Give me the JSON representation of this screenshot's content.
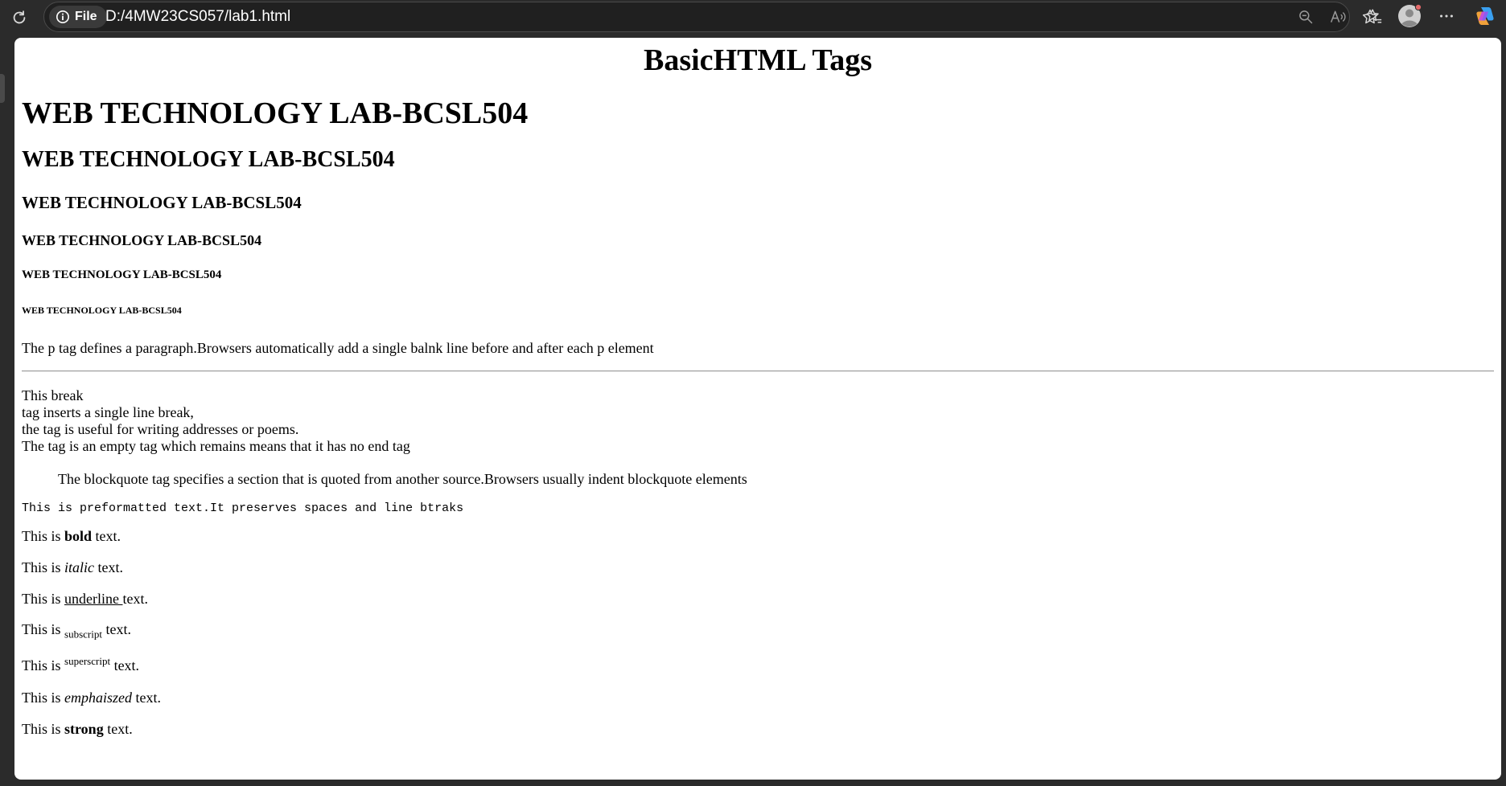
{
  "browser": {
    "site_info_label": "File",
    "url": "D:/4MW23CS057/lab1.html"
  },
  "page": {
    "centered_heading": "BasicHTML Tags",
    "h1": "WEB TECHNOLOGY LAB-BCSL504",
    "h2": "WEB TECHNOLOGY LAB-BCSL504",
    "h3": "WEB TECHNOLOGY LAB-BCSL504",
    "h4": "WEB TECHNOLOGY LAB-BCSL504",
    "h5": "WEB TECHNOLOGY LAB-BCSL504",
    "h6": "WEB TECHNOLOGY LAB-BCSL504",
    "paragraph": "The p tag defines a paragraph.Browsers automatically add a single balnk line before and after each p element",
    "break_lines": [
      "This break",
      "tag inserts a single line break,",
      "the tag is useful for writing addresses or poems.",
      "The tag is an empty tag which remains means that it has no end tag"
    ],
    "blockquote": "The blockquote tag specifies a section that is quoted from another source.Browsers usually indent blockquote elements",
    "preformatted": "This is preformatted text.It preserves spaces and line btraks",
    "prefix": "This is",
    "suffix": "text.",
    "bold_word": "bold",
    "italic_word": "italic",
    "underline_word": "underline",
    "subscript_word": "subscript",
    "superscript_word": "superscript",
    "emphasized_word": "emphaiszed",
    "strong_word": "strong"
  }
}
